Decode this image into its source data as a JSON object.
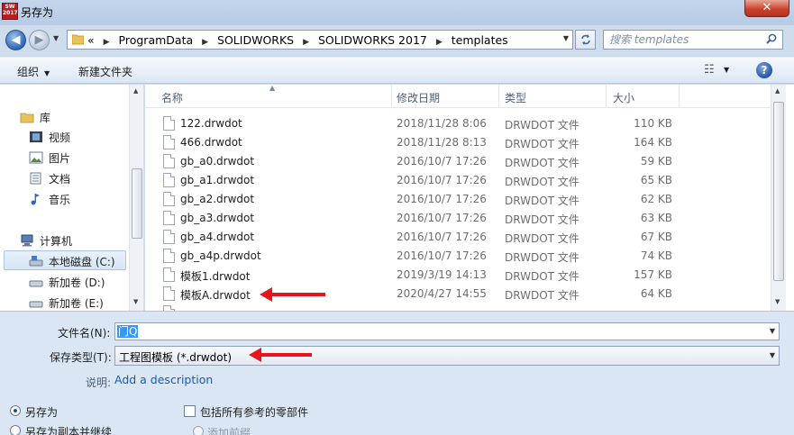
{
  "window": {
    "title": "另存为",
    "app_icon_text": [
      "SW",
      "2017"
    ],
    "close_label": "✕"
  },
  "nav": {
    "back_glyph": "◀",
    "forward_glyph": "▶"
  },
  "address": {
    "prefix": "«",
    "breadcrumbs": [
      "ProgramData",
      "SOLIDWORKS",
      "SOLIDWORKS 2017",
      "templates"
    ]
  },
  "search": {
    "placeholder": "搜索 templates"
  },
  "toolbar": {
    "organize_label": "组织",
    "new_folder_label": "新建文件夹",
    "help_label": "?"
  },
  "sidebar": {
    "items": [
      {
        "label": "库",
        "icon": "library-icon"
      },
      {
        "label": "视频",
        "icon": "video-icon"
      },
      {
        "label": "图片",
        "icon": "picture-icon"
      },
      {
        "label": "文档",
        "icon": "document-icon"
      },
      {
        "label": "音乐",
        "icon": "music-icon"
      },
      {
        "label": "计算机",
        "icon": "computer-icon"
      },
      {
        "label": "本地磁盘 (C:)",
        "icon": "drive-icon"
      },
      {
        "label": "新加卷 (D:)",
        "icon": "drive-icon"
      },
      {
        "label": "新加卷 (E:)",
        "icon": "drive-icon"
      }
    ],
    "selected_index": 6
  },
  "file_list": {
    "columns": [
      "名称",
      "修改日期",
      "类型",
      "大小"
    ],
    "rows": [
      {
        "name": "122.drwdot",
        "date": "2018/11/28 8:06",
        "type": "DRWDOT 文件",
        "size": "110 KB"
      },
      {
        "name": "466.drwdot",
        "date": "2018/11/28 8:13",
        "type": "DRWDOT 文件",
        "size": "164 KB"
      },
      {
        "name": "gb_a0.drwdot",
        "date": "2016/10/7 17:26",
        "type": "DRWDOT 文件",
        "size": "59 KB"
      },
      {
        "name": "gb_a1.drwdot",
        "date": "2016/10/7 17:26",
        "type": "DRWDOT 文件",
        "size": "65 KB"
      },
      {
        "name": "gb_a2.drwdot",
        "date": "2016/10/7 17:26",
        "type": "DRWDOT 文件",
        "size": "62 KB"
      },
      {
        "name": "gb_a3.drwdot",
        "date": "2016/10/7 17:26",
        "type": "DRWDOT 文件",
        "size": "63 KB"
      },
      {
        "name": "gb_a4.drwdot",
        "date": "2016/10/7 17:26",
        "type": "DRWDOT 文件",
        "size": "67 KB"
      },
      {
        "name": "gb_a4p.drwdot",
        "date": "2016/10/7 17:26",
        "type": "DRWDOT 文件",
        "size": "74 KB"
      },
      {
        "name": "模板1.drwdot",
        "date": "2019/3/19 14:13",
        "type": "DRWDOT 文件",
        "size": "157 KB"
      },
      {
        "name": "模板A.drwdot",
        "date": "2020/4/27 14:55",
        "type": "DRWDOT 文件",
        "size": "64 KB"
      }
    ]
  },
  "form": {
    "filename_label": "文件名(N):",
    "filename_value": "门Q",
    "savetype_label": "保存类型(T):",
    "savetype_value": "工程图模板 (*.drwdot)",
    "description_label": "说明:",
    "description_link": "Add a description",
    "radio_save_as": "另存为",
    "radio_save_copy": "另存为副本并继续",
    "checkbox_include_refs": "包括所有参考的零部件",
    "radio_add_prefix": "添加前缀"
  },
  "colors": {
    "annotation_arrow": "#e4161b",
    "link": "#1a5aad",
    "selection": "#3399ff"
  }
}
